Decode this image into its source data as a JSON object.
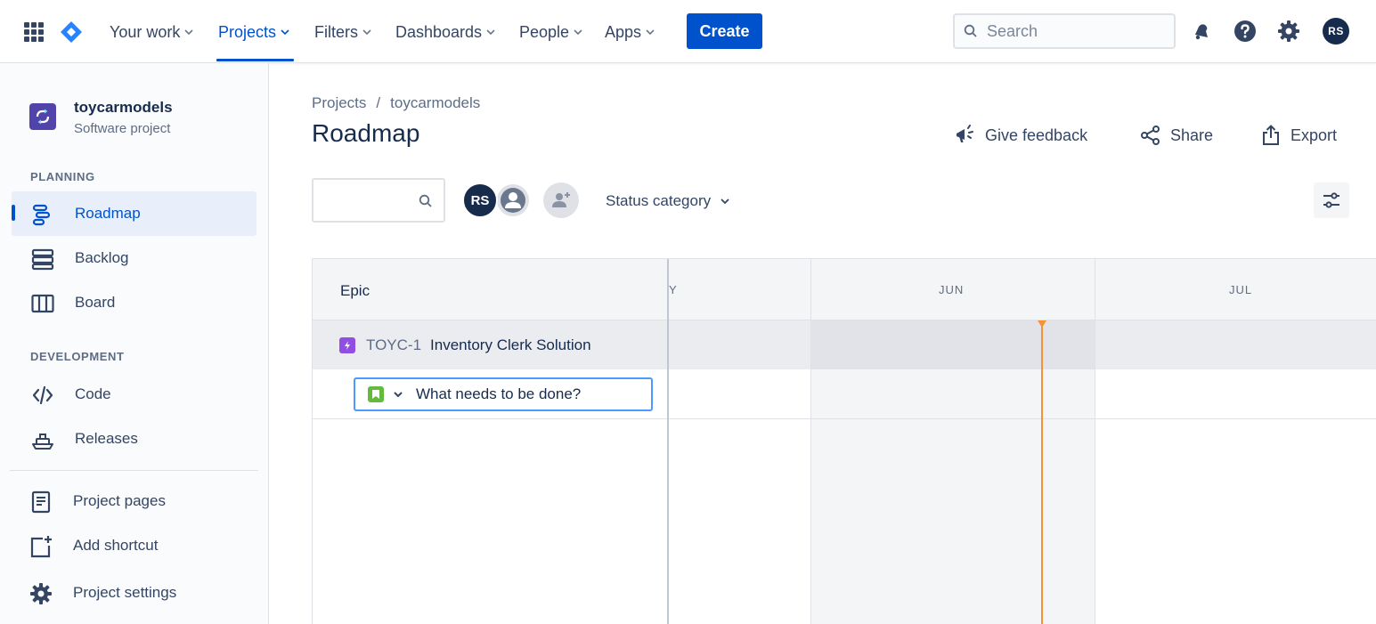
{
  "topnav": {
    "items": [
      {
        "label": "Your work",
        "active": false
      },
      {
        "label": "Projects",
        "active": true
      },
      {
        "label": "Filters",
        "active": false
      },
      {
        "label": "Dashboards",
        "active": false
      },
      {
        "label": "People",
        "active": false
      },
      {
        "label": "Apps",
        "active": false
      }
    ],
    "create_label": "Create",
    "search_placeholder": "Search",
    "user_initials": "RS",
    "icons": [
      "app-switcher-icon",
      "jira-logo-icon",
      "notifications-icon",
      "help-icon",
      "settings-icon"
    ]
  },
  "sidebar": {
    "project_name": "toycarmodels",
    "project_type": "Software project",
    "planning_heading": "PLANNING",
    "development_heading": "DEVELOPMENT",
    "planning_items": [
      {
        "label": "Roadmap",
        "icon": "roadmap-icon",
        "selected": true
      },
      {
        "label": "Backlog",
        "icon": "backlog-icon",
        "selected": false
      },
      {
        "label": "Board",
        "icon": "board-icon",
        "selected": false
      }
    ],
    "development_items": [
      {
        "label": "Code",
        "icon": "code-icon"
      },
      {
        "label": "Releases",
        "icon": "releases-icon"
      }
    ],
    "bottom_items": [
      {
        "label": "Project pages",
        "icon": "project-pages-icon"
      },
      {
        "label": "Add shortcut",
        "icon": "add-shortcut-icon"
      },
      {
        "label": "Project settings",
        "icon": "gear-icon"
      }
    ]
  },
  "main": {
    "breadcrumb": [
      "Projects",
      "/",
      "toycarmodels"
    ],
    "title": "Roadmap",
    "actions": [
      {
        "label": "Give feedback",
        "icon": "megaphone-icon"
      },
      {
        "label": "Share",
        "icon": "share-icon"
      },
      {
        "label": "Export",
        "icon": "export-icon"
      }
    ],
    "filters": {
      "search_value": "",
      "assignee_initials": "RS",
      "status_category_label": "Status category"
    }
  },
  "roadmap": {
    "epic_column_header": "Epic",
    "months": [
      "Y",
      "JUN",
      "JUL"
    ],
    "epic": {
      "key": "TOYC-1",
      "summary": "Inventory Clerk Solution"
    },
    "create_placeholder": "What needs to be done?",
    "colors": {
      "today_marker": "#f79232",
      "epic_icon": "#904ee2",
      "story_icon": "#63ba3c",
      "accent": "#0052cc"
    }
  }
}
